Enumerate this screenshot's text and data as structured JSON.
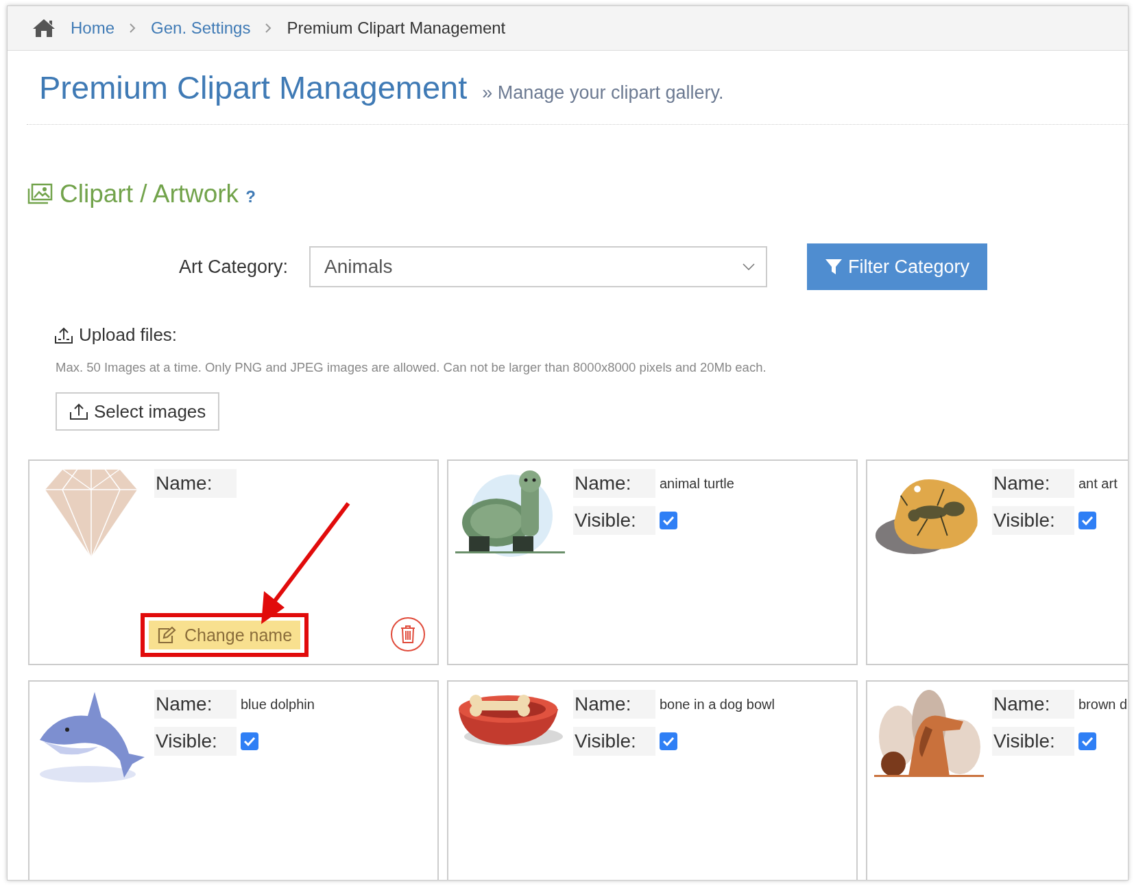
{
  "breadcrumb": [
    {
      "label": "Home",
      "link": true
    },
    {
      "label": "Gen. Settings",
      "link": true
    },
    {
      "label": "Premium Clipart Management",
      "link": false
    }
  ],
  "page_title": "Premium Clipart Management",
  "page_subtitle": "» Manage your clipart gallery.",
  "section": {
    "title": "Clipart / Artwork",
    "help": "?"
  },
  "filter": {
    "label": "Art Category:",
    "value": "Animals",
    "button": "Filter Category"
  },
  "upload": {
    "label": "Upload files:",
    "hint": "Max. 50 Images at a time. Only PNG and JPEG images are allowed. Can not be larger than 8000x8000 pixels and 20Mb each.",
    "button": "Select images"
  },
  "cards": [
    {
      "name_label": "Name:",
      "rename_button": "Change name",
      "highlighted": true
    },
    {
      "name_label": "Name:",
      "name": "animal turtle",
      "visible_label": "Visible:",
      "visible": true
    },
    {
      "name_label": "Name:",
      "name": "ant art",
      "visible_label": "Visible:",
      "visible": true
    },
    {
      "name_label": "Name:",
      "name": "blue dolphin",
      "visible_label": "Visible:",
      "visible": true
    },
    {
      "name_label": "Name:",
      "name": "bone in a dog bowl",
      "visible_label": "Visible:",
      "visible": true
    },
    {
      "name_label": "Name:",
      "name": "brown d",
      "visible_label": "Visible:",
      "visible": true
    }
  ]
}
